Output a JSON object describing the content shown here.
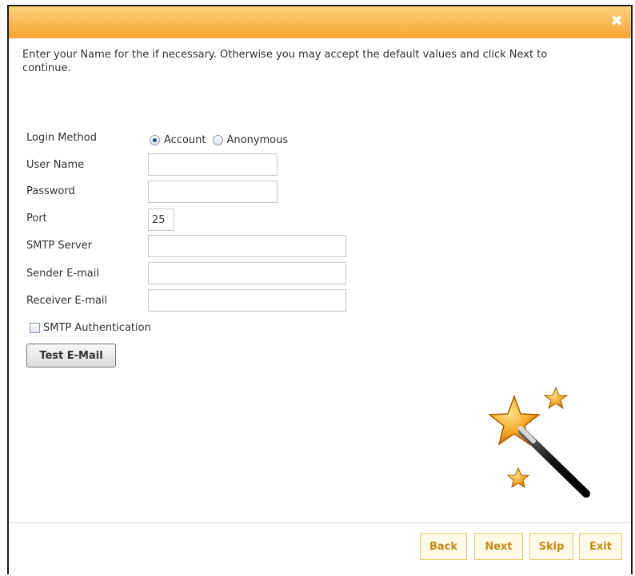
{
  "dialog": {
    "intro": "Enter your Name for the if necessary. Otherwise you may accept the default values and click Next to continue.",
    "close_symbol": "✖"
  },
  "form": {
    "login_method_label": "Login Method",
    "login_options": [
      "Account",
      "Anonymous"
    ],
    "selected_login": "Account",
    "user_name_label": "User Name",
    "user_name_value": "",
    "password_label": "Password",
    "password_value": "",
    "port_label": "Port",
    "port_value": "25",
    "smtp_server_label": "SMTP Server",
    "smtp_server_value": "",
    "sender_label": "Sender E-mail",
    "sender_value": "",
    "receiver_label": "Receiver E-mail",
    "receiver_value": "",
    "smtp_auth_label": "SMTP Authentication",
    "smtp_auth_checked": false,
    "test_button": "Test E-Mail"
  },
  "footer": {
    "back": "Back",
    "next": "Next",
    "skip": "Skip",
    "exit": "Exit"
  },
  "colors": {
    "titlebar_top": "#ffd27a",
    "titlebar_bottom": "#f7a534",
    "footer_button_text": "#c98a12",
    "footer_button_border": "#f2c66a"
  },
  "icons": {
    "close": "close-icon",
    "wizard": "magic-wand-icon"
  }
}
